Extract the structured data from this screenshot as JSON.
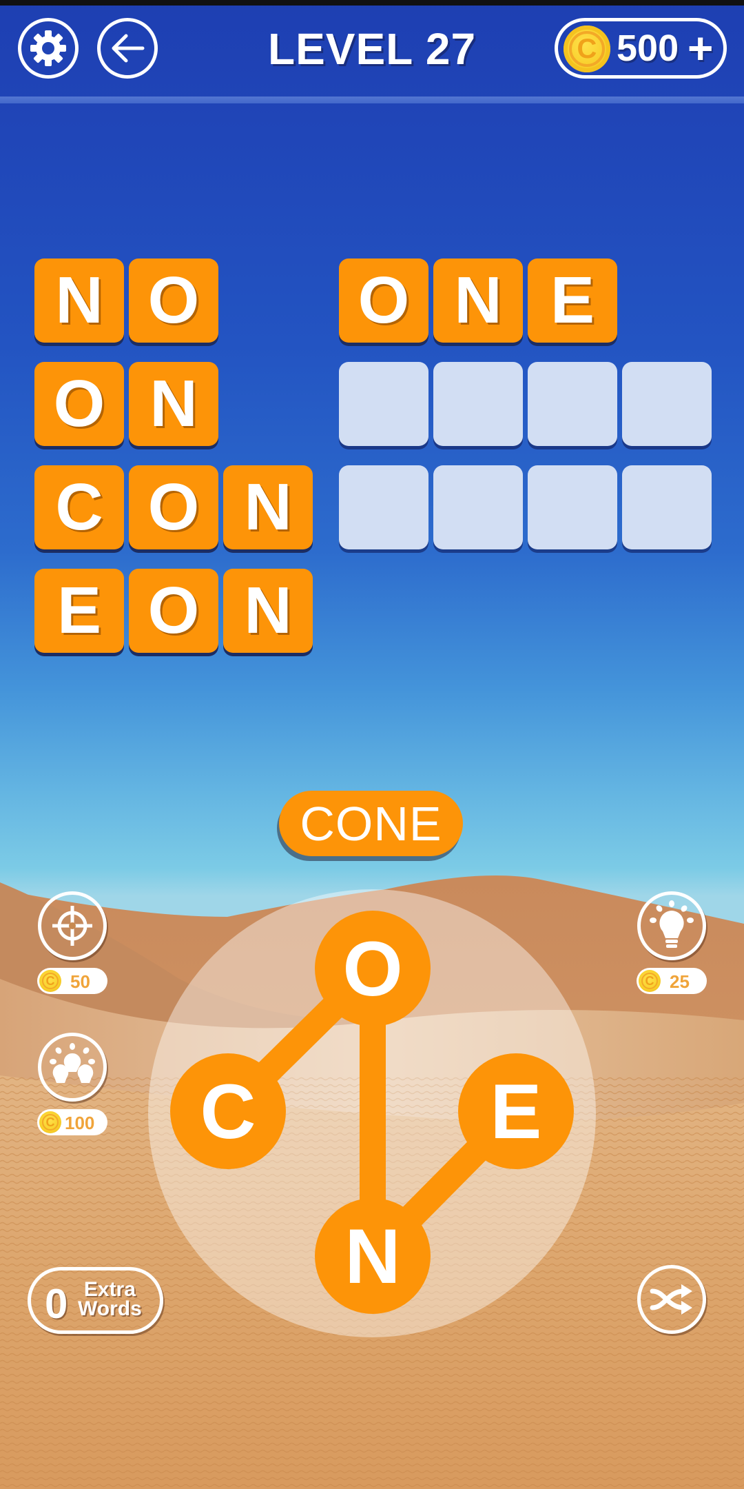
{
  "header": {
    "settings_icon": "gear-icon",
    "back_icon": "arrow-left-icon",
    "level_title": "LEVEL 27",
    "coins": "500",
    "coin_icon": "coin-icon",
    "coin_letter": "C",
    "add_coins_label": "+"
  },
  "colors": {
    "tile_orange": "#fd9408",
    "tile_empty": "#d2def3",
    "header_blue": "#1e3fb2",
    "coin_gold": "#f8cf2a",
    "price_text": "#f0a43a"
  },
  "board": {
    "left_column": [
      {
        "word": "NO",
        "solved": true,
        "letters": [
          "N",
          "O"
        ]
      },
      {
        "word": "ON",
        "solved": true,
        "letters": [
          "O",
          "N"
        ]
      },
      {
        "word": "CON",
        "solved": true,
        "letters": [
          "C",
          "O",
          "N"
        ]
      },
      {
        "word": "EON",
        "solved": true,
        "letters": [
          "E",
          "O",
          "N"
        ]
      }
    ],
    "right_column": [
      {
        "word": "ONE",
        "solved": true,
        "letters": [
          "O",
          "N",
          "E"
        ]
      },
      {
        "solved": false,
        "letters": [
          "",
          "",
          "",
          ""
        ]
      },
      {
        "solved": false,
        "letters": [
          "",
          "",
          "",
          ""
        ]
      }
    ]
  },
  "current_word": "CONE",
  "wheel": {
    "letters": [
      "O",
      "C",
      "E",
      "N"
    ],
    "selected_path": [
      "C",
      "O",
      "N",
      "E"
    ]
  },
  "powerups": {
    "target": {
      "icon": "target-icon",
      "price": "50"
    },
    "multi_hint": {
      "icon": "multi-bulb-icon",
      "price": "100"
    },
    "hint": {
      "icon": "lightbulb-icon",
      "price": "25"
    },
    "shuffle": {
      "icon": "shuffle-icon"
    }
  },
  "extra_words": {
    "count": "0",
    "label_line1": "Extra",
    "label_line2": "Words"
  }
}
